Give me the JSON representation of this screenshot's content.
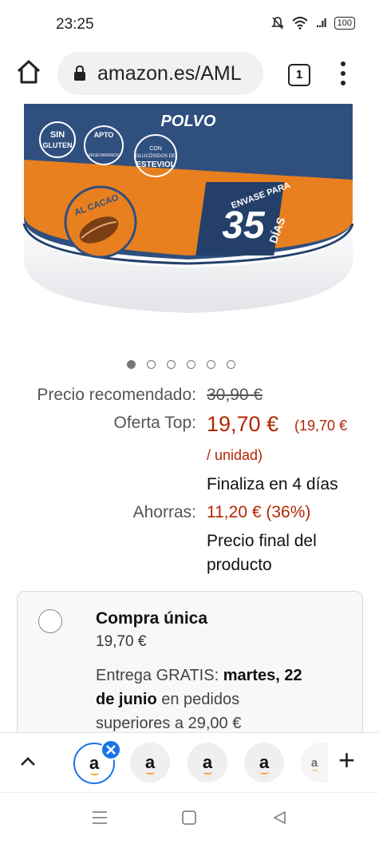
{
  "status": {
    "time": "23:25",
    "signal": "..ıl",
    "battery": "100"
  },
  "browser": {
    "url": "amazon.es/AML",
    "tab_count": "1"
  },
  "product_image": {
    "labels": [
      "POLVO",
      "SIN",
      "GLUTEN",
      "APTO",
      "VEGETARIANOS",
      "CON",
      "GLUCÓSIDOS DE",
      "ESTEVIOL",
      "AL CACAO",
      "ENVASE PARA",
      "35",
      "DÍAS"
    ],
    "colors": {
      "blue": "#2f4f7f",
      "orange": "#e8801f"
    },
    "carousel_count": 6,
    "carousel_active": 0
  },
  "pricing": {
    "recommended_label": "Precio recomendado:",
    "recommended_value": "30,90 €",
    "offer_label": "Oferta Top:",
    "offer_price": "19,70 €",
    "unit_price_a": "(19,70 €",
    "unit_price_b": "/ unidad)",
    "offer_ends": "Finaliza en 4 días",
    "savings_label": "Ahorras:",
    "savings_value": "11,20 € (36%)",
    "final_a": "Precio final del",
    "final_b": "producto"
  },
  "purchase_option": {
    "title": "Compra única",
    "price": "19,70 €",
    "delivery_a": "Entrega GRATIS:",
    "delivery_date_a": "martes, 22",
    "delivery_date_b": "de junio",
    "delivery_b": "en pedidos",
    "delivery_c": "superiores a 29,00 €"
  },
  "tab_strip": {
    "tabs": [
      "a",
      "a",
      "a",
      "a",
      "a"
    ],
    "add": "+"
  },
  "colors": {
    "price_red": "#b12704",
    "amazon_orange": "#f0a030",
    "close_blue": "#1a73e8"
  }
}
